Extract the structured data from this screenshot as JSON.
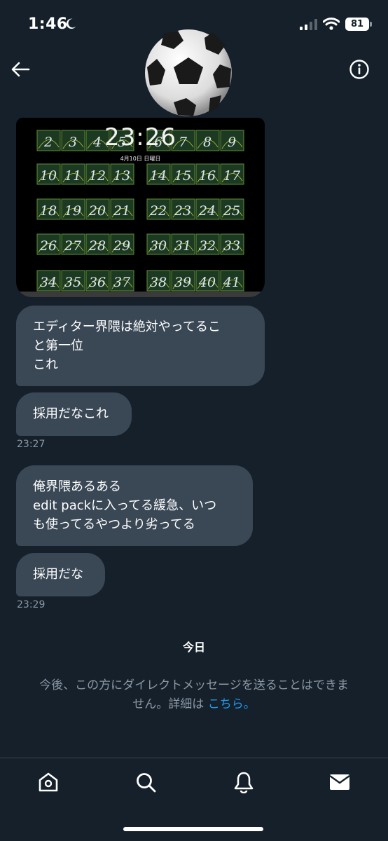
{
  "status_bar": {
    "time": "1:46",
    "battery": "81"
  },
  "header": {
    "back_icon": "arrow-left-icon",
    "info_icon": "info-icon",
    "avatar_icon": "soccer-ball-avatar"
  },
  "media": {
    "clock": "23:26",
    "date": "4月10日 日曜日",
    "rows": [
      [
        "2",
        "3",
        "4",
        "5",
        "6",
        "7",
        "8",
        "9"
      ],
      [
        "10",
        "11",
        "12",
        "13",
        "14",
        "15",
        "16",
        "17"
      ],
      [
        "18",
        "19",
        "20",
        "21",
        "22",
        "23",
        "24",
        "25"
      ],
      [
        "26",
        "27",
        "28",
        "29",
        "30",
        "31",
        "32",
        "33"
      ],
      [
        "34",
        "35",
        "36",
        "37",
        "38",
        "39",
        "40",
        "41"
      ]
    ]
  },
  "messages": [
    {
      "lines": [
        "エディター界隈は絶対やってるこ",
        "と第一位",
        "これ"
      ]
    },
    {
      "lines": [
        "採用だなこれ"
      ],
      "time": "23:27"
    },
    {
      "lines": [
        "俺界隈あるある",
        "edit packに入ってる緩急、いつ",
        "も使ってるやつより劣ってる"
      ]
    },
    {
      "lines": [
        "採用だな"
      ],
      "time": "23:29"
    }
  ],
  "day_label": "今日",
  "notice": {
    "line1": "今後、この方にダイレクトメッセージを送ることはできま",
    "line2": "せん。詳細は",
    "link": "こちら。"
  },
  "nav": {
    "items": [
      "home-icon",
      "search-icon",
      "bell-icon",
      "mail-icon"
    ]
  },
  "colors": {
    "background": "#15202b",
    "bubble": "#3a4856",
    "link": "#1d9bf0",
    "muted": "#8b98a5"
  }
}
